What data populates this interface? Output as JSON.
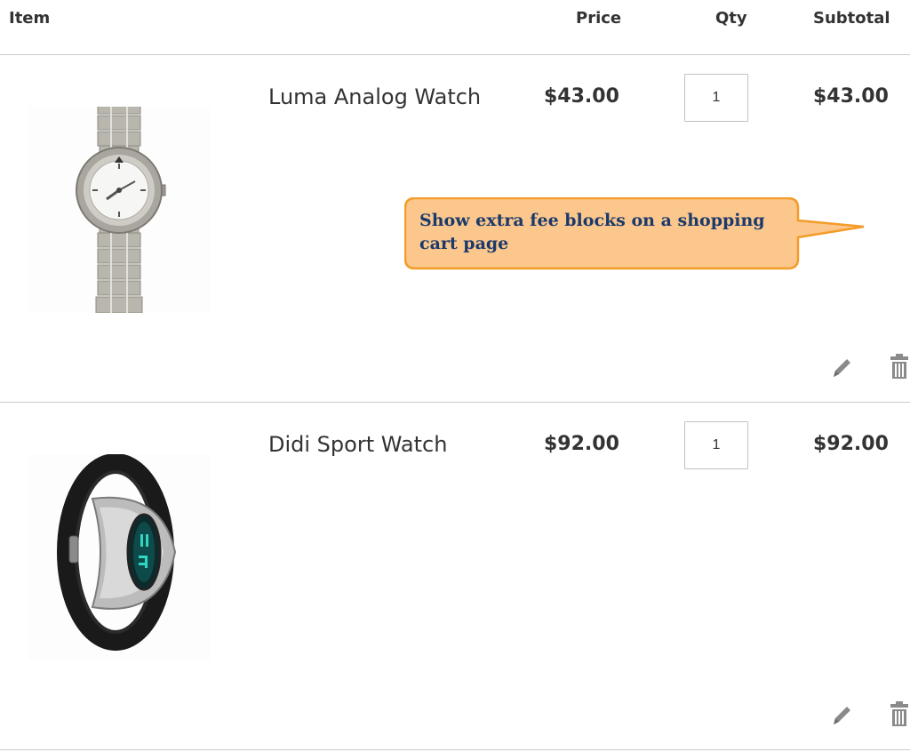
{
  "table": {
    "headers": {
      "item": "Item",
      "price": "Price",
      "qty": "Qty",
      "subtotal": "Subtotal"
    },
    "rows": [
      {
        "name": "Luma Analog Watch",
        "price": "$43.00",
        "qty": "1",
        "subtotal": "$43.00",
        "image_icon": "analog-watch-image",
        "actions": [
          "edit-icon",
          "delete-icon"
        ]
      },
      {
        "name": "Didi Sport Watch",
        "price": "$92.00",
        "qty": "1",
        "subtotal": "$92.00",
        "image_icon": "sport-watch-image",
        "actions": [
          "edit-icon",
          "delete-icon"
        ]
      }
    ]
  },
  "callout": {
    "text": "Show extra fee blocks on a shopping cart page",
    "fill_color": "#fcc78c",
    "border_color": "#f39c28",
    "text_color": "#1b3a6b"
  }
}
